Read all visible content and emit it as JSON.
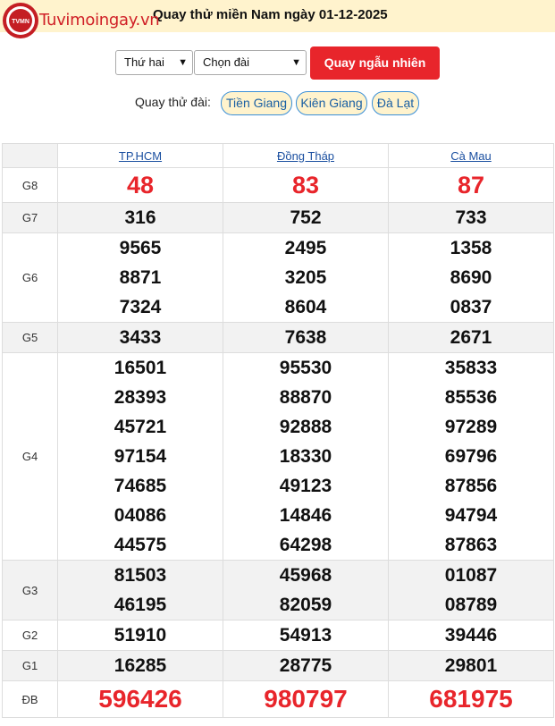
{
  "header": {
    "logo_text": "Tuvimoingay.vn",
    "logo_badge": "TVMN",
    "title": "Quay thử miền Nam ngày 01-12-2025"
  },
  "controls": {
    "day_select": "Thứ hai",
    "station_select": "Chọn đài",
    "random_button": "Quay ngẫu nhiên"
  },
  "quick": {
    "label": "Quay thử đài:",
    "stations": [
      "Tiền Giang",
      "Kiên Giang",
      "Đà Lạt"
    ]
  },
  "table": {
    "columns": [
      "TP.HCM",
      "Đồng Tháp",
      "Cà Mau"
    ],
    "rows": [
      {
        "label": "G8",
        "values": [
          [
            "48"
          ],
          [
            "83"
          ],
          [
            "87"
          ]
        ]
      },
      {
        "label": "G7",
        "values": [
          [
            "316"
          ],
          [
            "752"
          ],
          [
            "733"
          ]
        ]
      },
      {
        "label": "G6",
        "values": [
          [
            "9565",
            "8871",
            "7324"
          ],
          [
            "2495",
            "3205",
            "8604"
          ],
          [
            "1358",
            "8690",
            "0837"
          ]
        ]
      },
      {
        "label": "G5",
        "values": [
          [
            "3433"
          ],
          [
            "7638"
          ],
          [
            "2671"
          ]
        ]
      },
      {
        "label": "G4",
        "values": [
          [
            "16501",
            "28393",
            "45721",
            "97154",
            "74685",
            "04086",
            "44575"
          ],
          [
            "95530",
            "88870",
            "92888",
            "18330",
            "49123",
            "14846",
            "64298"
          ],
          [
            "35833",
            "85536",
            "97289",
            "69796",
            "87856",
            "94794",
            "87863"
          ]
        ]
      },
      {
        "label": "G3",
        "values": [
          [
            "81503",
            "46195"
          ],
          [
            "45968",
            "82059"
          ],
          [
            "01087",
            "08789"
          ]
        ]
      },
      {
        "label": "G2",
        "values": [
          [
            "51910"
          ],
          [
            "54913"
          ],
          [
            "39446"
          ]
        ]
      },
      {
        "label": "G1",
        "values": [
          [
            "16285"
          ],
          [
            "28775"
          ],
          [
            "29801"
          ]
        ]
      },
      {
        "label": "ĐB",
        "values": [
          [
            "596426"
          ],
          [
            "980797"
          ],
          [
            "681975"
          ]
        ]
      }
    ]
  }
}
